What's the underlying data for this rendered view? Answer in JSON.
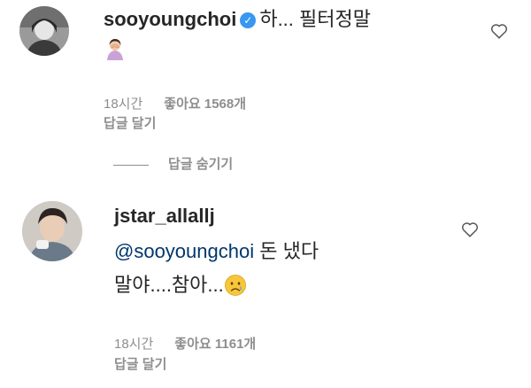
{
  "comments": [
    {
      "username": "sooyoungchoi",
      "verified": true,
      "text": "하... 필터정말",
      "emoji_icon": "person-facepalm-icon",
      "time": "18시간",
      "likes": "좋아요 1568개",
      "reply_label": "답글 달기",
      "hide_replies_label": "답글 숨기기"
    },
    {
      "username": "jstar_allallj",
      "verified": false,
      "mention": "@sooyoungchoi",
      "text_line1": " 돈 냈다",
      "text_line2": "말야....참아...",
      "emoji_icon": "crying-face-icon",
      "time": "18시간",
      "likes": "좋아요 1161개",
      "reply_label": "답글 달기"
    }
  ],
  "colors": {
    "text": "#262626",
    "meta": "#8e8e8e",
    "mention": "#00376b",
    "verified": "#3897f0"
  }
}
